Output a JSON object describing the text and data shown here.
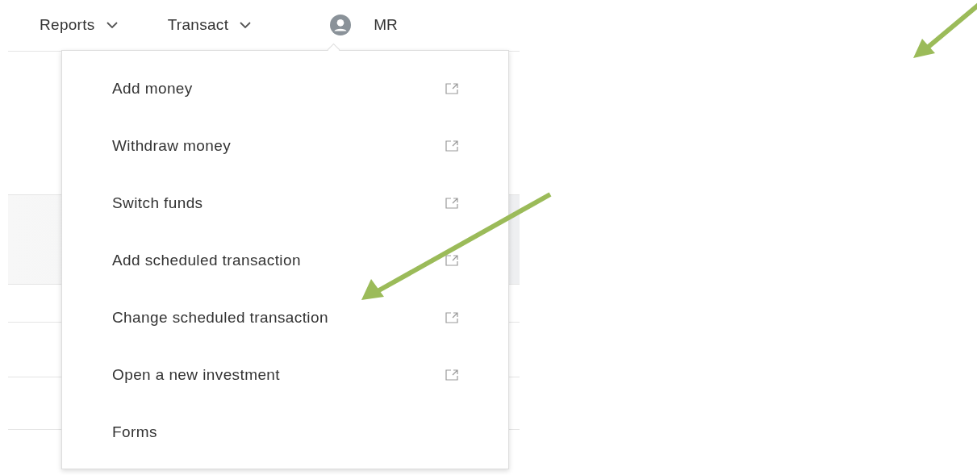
{
  "nav": [
    {
      "label": "Reports",
      "kind": "dropdown"
    },
    {
      "label": "Transact",
      "kind": "dropdown"
    },
    {
      "label": "MR",
      "kind": "user"
    }
  ],
  "menu": {
    "items": [
      {
        "label": "Add money",
        "external": true
      },
      {
        "label": "Withdraw money",
        "external": true
      },
      {
        "label": "Switch funds",
        "external": true
      },
      {
        "label": "Add scheduled transaction",
        "external": true
      },
      {
        "label": "Change scheduled transaction",
        "external": true
      },
      {
        "label": "Open a new investment",
        "external": true
      },
      {
        "label": "Forms",
        "external": false
      }
    ]
  }
}
